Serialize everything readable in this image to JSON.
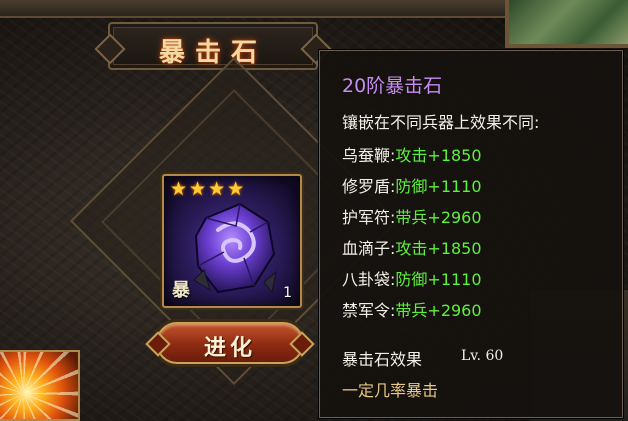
{
  "panel": {
    "title": "暴击石"
  },
  "item": {
    "stars": 4,
    "type_char": "暴",
    "count": "1"
  },
  "buttons": {
    "evolve_label": "进化"
  },
  "tooltip": {
    "title": "20阶暴击石",
    "subtitle": "镶嵌在不同兵器上效果不同:",
    "effects": [
      {
        "weapon": "乌蚕鞭",
        "stat": "攻击+1850"
      },
      {
        "weapon": "修罗盾",
        "stat": "防御+1110"
      },
      {
        "weapon": "护军符",
        "stat": "带兵+2960"
      },
      {
        "weapon": "血滴子",
        "stat": "攻击+1850"
      },
      {
        "weapon": "八卦袋",
        "stat": "防御+1110"
      },
      {
        "weapon": "禁军令",
        "stat": "带兵+2960"
      }
    ],
    "effect_separator": ":",
    "effect_name": "暴击石效果",
    "level": "Lv. 60",
    "description": "一定几率暴击"
  },
  "colors": {
    "title_purple": "#c78cf2",
    "stat_green": "#5ef13c",
    "desc_gold": "#e8c884",
    "button_red": "#8e2a12",
    "star_gold": "#ffcc33"
  },
  "icons": {
    "star": "star-icon",
    "stone": "purple-crit-stone-icon",
    "skill": "flame-burst-skill-icon"
  }
}
